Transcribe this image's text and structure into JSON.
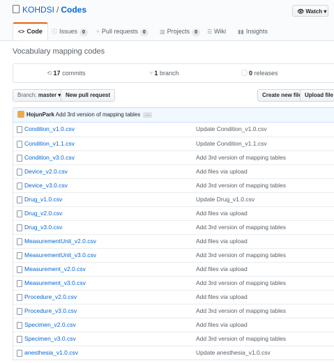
{
  "repo": {
    "owner": "KOHDSI",
    "separator": "/",
    "name": "Codes"
  },
  "watch": {
    "icon": "eye-icon",
    "label": "Watch",
    "caret": "▾"
  },
  "tabs": [
    {
      "icon": "code-icon",
      "label": "Code"
    },
    {
      "icon": "issue-icon",
      "label": "Issues",
      "count": "0"
    },
    {
      "icon": "pull-request-icon",
      "label": "Pull requests",
      "count": "0"
    },
    {
      "icon": "project-icon",
      "label": "Projects",
      "count": "0"
    },
    {
      "icon": "wiki-icon",
      "label": "Wiki"
    },
    {
      "icon": "graph-icon",
      "label": "Insights"
    }
  ],
  "description": "Vocabulary mapping codes",
  "numbers": {
    "commits_count": "17",
    "commits_label": "commits",
    "branch_count": "1",
    "branch_label": "branch",
    "releases_count": "0",
    "releases_label": "releases"
  },
  "toolbar": {
    "branch_prefix": "Branch:",
    "branch_value": "master ▾",
    "new_pr": "New pull request",
    "create_file": "Create new file",
    "upload_files": "Upload file"
  },
  "commit": {
    "author": "HojunPark",
    "message": "Add 3rd version of mapping tables",
    "ellipsis": "…"
  },
  "files": [
    {
      "name": "Condition_v1.0.csv",
      "message": "Update Condition_v1.0.csv"
    },
    {
      "name": "Condition_v1.1.csv",
      "message": "Update Condition_v1.1.csv"
    },
    {
      "name": "Condition_v3.0.csv",
      "message": "Add 3rd version of mapping tables"
    },
    {
      "name": "Device_v2.0.csv",
      "message": "Add files via upload"
    },
    {
      "name": "Device_v3.0.csv",
      "message": "Add 3rd version of mapping tables"
    },
    {
      "name": "Drug_v1.0.csv",
      "message": "Update Drug_v1.0.csv"
    },
    {
      "name": "Drug_v2.0.csv",
      "message": "Add files via upload"
    },
    {
      "name": "Drug_v3.0.csv",
      "message": "Add 3rd version of mapping tables"
    },
    {
      "name": "MeasurementUnit_v2.0.csv",
      "message": "Add files via upload"
    },
    {
      "name": "MeasurementUnit_v3.0.csv",
      "message": "Add 3rd version of mapping tables"
    },
    {
      "name": "Measurement_v2.0.csv",
      "message": "Add files via upload"
    },
    {
      "name": "Measurement_v3.0.csv",
      "message": "Add 3rd version of mapping tables"
    },
    {
      "name": "Procedure_v2.0.csv",
      "message": "Add files via upload"
    },
    {
      "name": "Procedure_v3.0.csv",
      "message": "Add 3rd version of mapping tables"
    },
    {
      "name": "Specimen_v2.0.csv",
      "message": "Add files via upload"
    },
    {
      "name": "Specimen_v3.0.csv",
      "message": "Add 3rd version of mapping tables"
    },
    {
      "name": "anesthesia_v1.0.csv",
      "message": "Update anesthesia_v1.0.csv"
    }
  ],
  "colors": {
    "link": "#0366d6",
    "tab_accent": "#e36209",
    "commit_bg": "#f1f8ff",
    "header_bg": "#fafbfc"
  }
}
